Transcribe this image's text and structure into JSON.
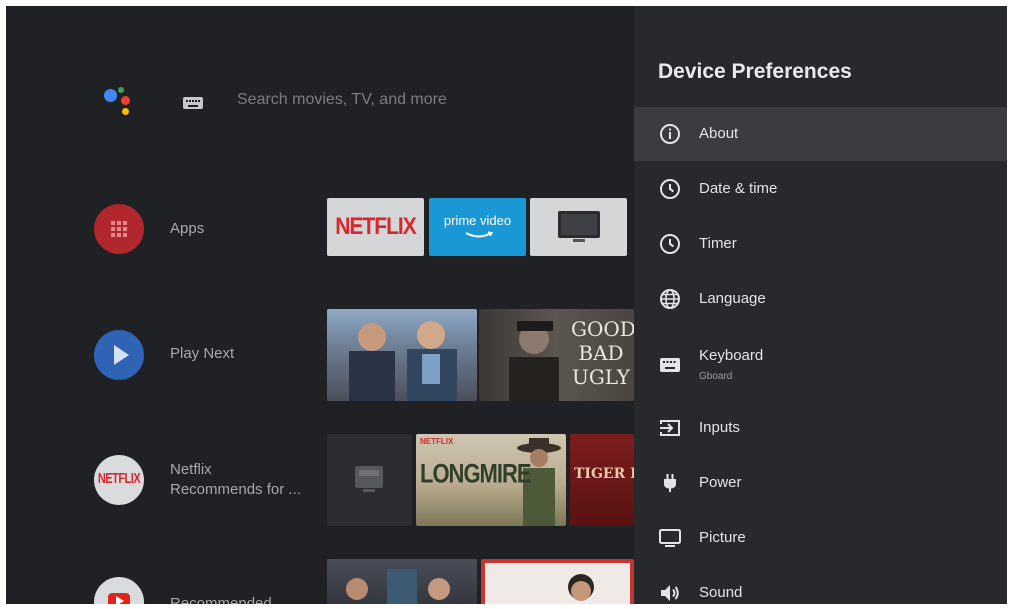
{
  "search": {
    "placeholder": "Search movies, TV, and more"
  },
  "rows": [
    {
      "label": "Apps"
    },
    {
      "label": "Play Next"
    },
    {
      "label_line1": "Netflix",
      "label_line2": "Recommends for ..."
    },
    {
      "label": "Recommended"
    }
  ],
  "apps": {
    "netflix_text": "NETFLIX",
    "prime_line1": "prime video"
  },
  "posters": {
    "good_bad_ugly_lines": [
      "GOOD",
      "BAD",
      "UGLY"
    ],
    "longmire": "LONGMIRE",
    "longmire_badge": "NETFLIX",
    "tiger_king": "TIGER KING",
    "netflix_circle": "NETFLIX"
  },
  "settings": {
    "title": "Device Preferences",
    "items": [
      {
        "label": "About",
        "icon": "info-icon",
        "active": true
      },
      {
        "label": "Date & time",
        "icon": "clock-icon"
      },
      {
        "label": "Timer",
        "icon": "timer-icon"
      },
      {
        "label": "Language",
        "icon": "globe-icon"
      },
      {
        "label": "Keyboard",
        "sub": "Gboard",
        "icon": "keyboard-icon"
      },
      {
        "label": "Inputs",
        "icon": "input-icon"
      },
      {
        "label": "Power",
        "icon": "power-plug-icon"
      },
      {
        "label": "Picture",
        "icon": "monitor-icon"
      },
      {
        "label": "Sound",
        "icon": "speaker-icon"
      }
    ]
  },
  "colors": {
    "background": "#202124",
    "panel": "#27292c",
    "highlight": "#3a3c40",
    "apps_red": "#b0272d",
    "play_blue": "#2f63b6",
    "netflix_red": "#d8272e",
    "prime_blue": "#1a98d6"
  }
}
